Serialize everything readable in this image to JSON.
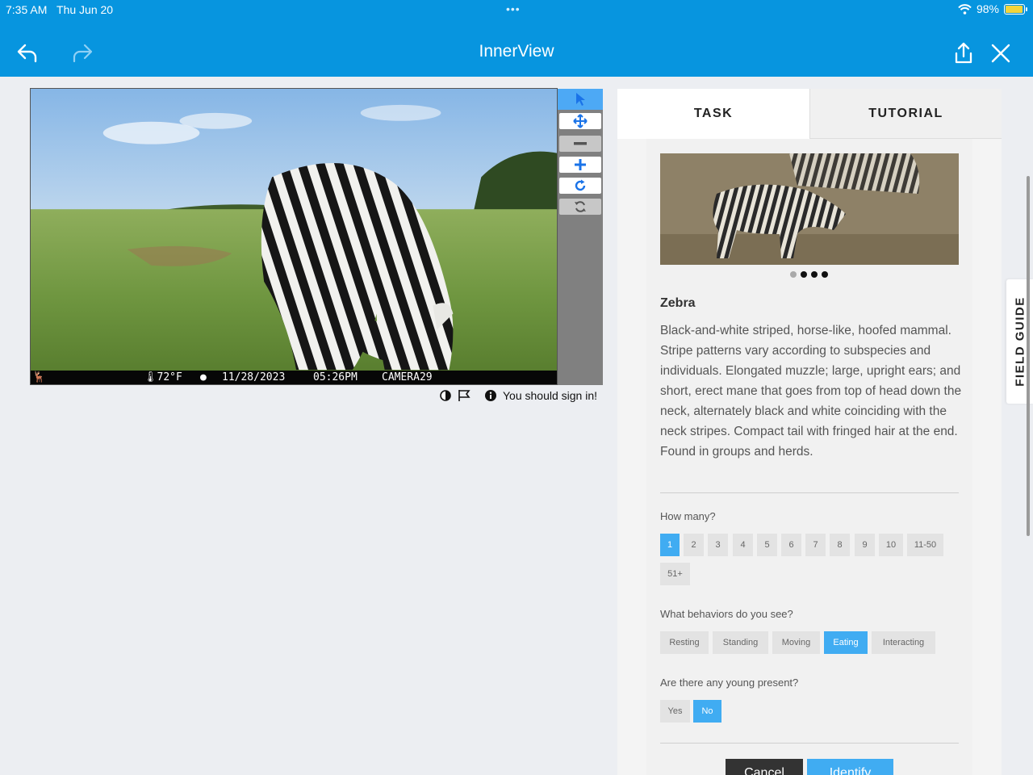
{
  "status_bar": {
    "time": "7:35 AM",
    "date": "Thu Jun 20",
    "dots": "•••",
    "battery": "98%",
    "battery_level": 0.98,
    "wifi_icon": "wifi-icon",
    "battery_icon": "battery-icon"
  },
  "header": {
    "title": "InnerView",
    "icons": [
      "back-arrow-icon",
      "forward-arrow-icon",
      "share-icon",
      "close-icon"
    ]
  },
  "viewer": {
    "strip": {
      "temperature": "72°F",
      "date": "11/28/2023",
      "time": "05:26PM",
      "camera": "CAMERA29"
    },
    "tools": [
      "pointer-icon",
      "pan-icon",
      "zoom-out-icon",
      "zoom-in-icon",
      "rotate-icon",
      "reset-icon"
    ],
    "info_icons": [
      "contrast-icon",
      "flag-icon",
      "info-icon"
    ],
    "sign_in_text": "You should sign in!"
  },
  "panel": {
    "tabs": {
      "task": "TASK",
      "tutorial": "TUTORIAL"
    },
    "species_name": "Zebra",
    "species_description": "Black-and-white striped, horse-like, hoofed mammal. Stripe patterns vary according to subspecies and individuals. Elongated muzzle; large, upright ears; and short, erect mane that goes from top of head down the neck, alternately black and white coinciding with the neck stripes. Compact tail with fringed hair at the end. Found in groups and herds.",
    "how_many": {
      "label": "How many?",
      "options": [
        "1",
        "2",
        "3",
        "4",
        "5",
        "6",
        "7",
        "8",
        "9",
        "10",
        "11-50",
        "51+"
      ],
      "selected": "1"
    },
    "behaviors": {
      "label": "What behaviors do you see?",
      "options": [
        "Resting",
        "Standing",
        "Moving",
        "Eating",
        "Interacting"
      ],
      "selected": "Eating"
    },
    "young": {
      "label": "Are there any young present?",
      "options": [
        "Yes",
        "No"
      ],
      "selected": "No"
    },
    "cancel_label": "Cancel",
    "identify_label": "Identify",
    "colors": {
      "accent": "#40acf2",
      "header": "#0795df",
      "cancel": "#333333",
      "identify": "#40acf2"
    }
  },
  "field_guide_label": "FIELD GUIDE"
}
